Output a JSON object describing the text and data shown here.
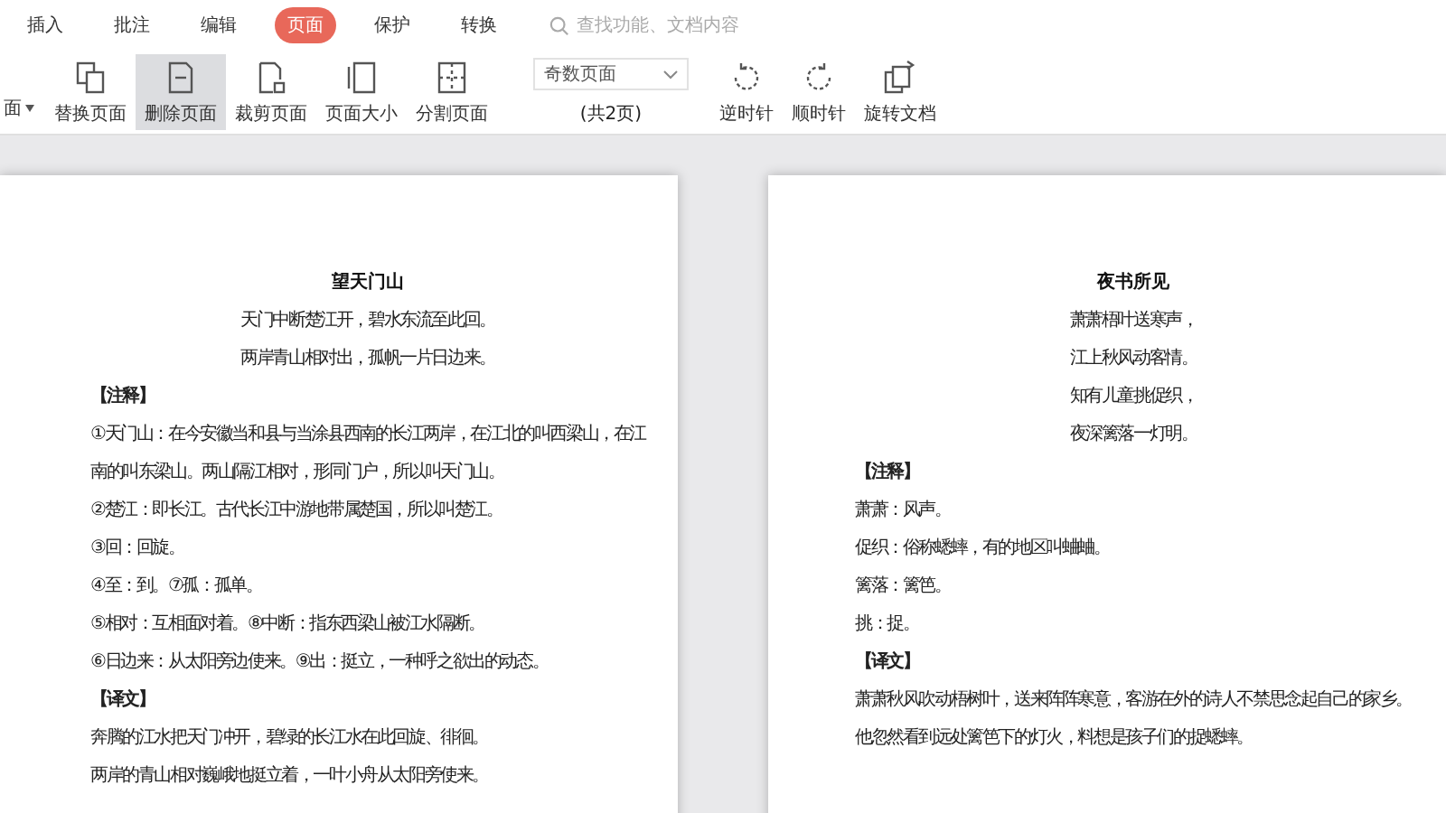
{
  "menu_tabs": [
    {
      "label": "插入",
      "selected": false
    },
    {
      "label": "批注",
      "selected": false
    },
    {
      "label": "编辑",
      "selected": false
    },
    {
      "label": "页面",
      "selected": true
    },
    {
      "label": "保护",
      "selected": false
    },
    {
      "label": "转换",
      "selected": false
    }
  ],
  "search": {
    "placeholder": "查找功能、文档内容"
  },
  "toolbar": {
    "cut_button": {
      "label": "面"
    },
    "buttons": [
      {
        "label": "替换页面",
        "selected": false
      },
      {
        "label": "删除页面",
        "selected": true
      },
      {
        "label": "裁剪页面",
        "selected": false
      },
      {
        "label": "页面大小",
        "selected": false
      },
      {
        "label": "分割页面",
        "selected": false
      }
    ],
    "page_select": {
      "value": "奇数页面",
      "caption": "(共2页)"
    },
    "rotate_buttons": [
      {
        "label": "逆时针"
      },
      {
        "label": "顺时针"
      },
      {
        "label": "旋转文档"
      }
    ]
  },
  "pages": [
    {
      "title": "望天门山",
      "lines": [
        {
          "kind": "center",
          "text": "天门中断楚江开，碧水东流至此回。"
        },
        {
          "kind": "center",
          "text": "两岸青山相对出，孤帆一片日边来。"
        },
        {
          "kind": "heading",
          "text": "【注释】"
        },
        {
          "kind": "left",
          "text": "①天门山：在今安徽当和县与当涂县西南的长江两岸，在江北的叫西梁山，在江"
        },
        {
          "kind": "left",
          "text": "南的叫东梁山。两山隔江相对，形同门户，所以叫天门山。"
        },
        {
          "kind": "left",
          "text": "②楚江：即长江。古代长江中游地带属楚国，所以叫楚江。"
        },
        {
          "kind": "left",
          "text": "③回：回旋。"
        },
        {
          "kind": "left",
          "text": "④至：到。⑦孤：孤单。"
        },
        {
          "kind": "left",
          "text": "⑤相对：互相面对着。⑧中断：指东西梁山被江水隔断。"
        },
        {
          "kind": "left",
          "text": "⑥日边来：从太阳旁边使来。⑨出：挺立，一种呼之欲出的动态。"
        },
        {
          "kind": "heading",
          "text": "【译文】"
        },
        {
          "kind": "left",
          "text": "奔腾的江水把天门冲开，碧绿的长江水在此回旋、徘徊。"
        },
        {
          "kind": "left",
          "text": "两岸的青山相对巍峨地挺立着，一叶小舟从太阳旁使来。"
        }
      ]
    },
    {
      "title": "夜书所见",
      "lines": [
        {
          "kind": "center",
          "text": "萧萧梧叶送寒声，"
        },
        {
          "kind": "center",
          "text": "江上秋风动客情。"
        },
        {
          "kind": "center",
          "text": "知有儿童挑促织，"
        },
        {
          "kind": "center",
          "text": "夜深篱落一灯明。"
        },
        {
          "kind": "heading",
          "text": "【注释】"
        },
        {
          "kind": "left",
          "text": "萧萧：风声。"
        },
        {
          "kind": "left",
          "text": "促织：俗称蟋蟀，有的地区叫蛐蛐。"
        },
        {
          "kind": "left",
          "text": "篱落：篱笆。"
        },
        {
          "kind": "left",
          "text": "挑：捉。"
        },
        {
          "kind": "heading",
          "text": "【译文】"
        },
        {
          "kind": "left",
          "text": "萧萧秋风吹动梧树叶，送来阵阵寒意，客游在外的诗人不禁思念起自己的家乡。"
        },
        {
          "kind": "left",
          "text": "他忽然看到远处篱笆下的灯火，料想是孩子们的捉蟋蟀。"
        }
      ]
    }
  ]
}
